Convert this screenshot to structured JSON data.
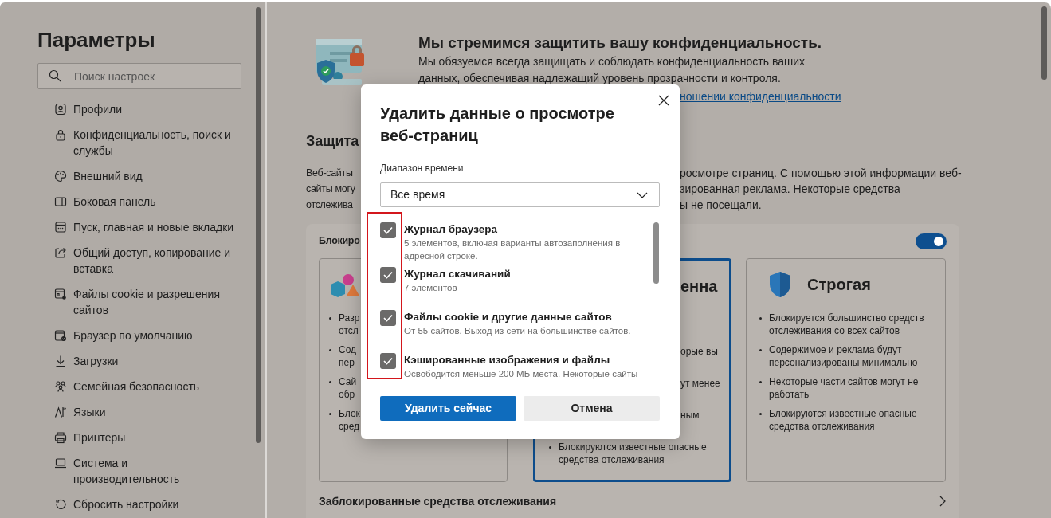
{
  "sidebar": {
    "title": "Параметры",
    "search": {
      "placeholder": "Поиск настроек"
    },
    "items": [
      {
        "label": "Профили",
        "selected": false
      },
      {
        "label": "Конфиденциальность, поиск и службы",
        "selected": false
      },
      {
        "label": "Внешний вид",
        "selected": false
      },
      {
        "label": "Боковая панель",
        "selected": false
      },
      {
        "label": "Пуск, главная и новые вкладки",
        "selected": false
      },
      {
        "label": "Общий доступ, копирование и вставка",
        "selected": false
      },
      {
        "label": "Файлы cookie и разрешения сайтов",
        "selected": false
      },
      {
        "label": "Браузер по умолчанию",
        "selected": false
      },
      {
        "label": "Загрузки",
        "selected": false
      },
      {
        "label": "Семейная безопасность",
        "selected": false
      },
      {
        "label": "Языки",
        "selected": false
      },
      {
        "label": "Принтеры",
        "selected": false
      },
      {
        "label": "Система и производительность",
        "selected": false
      },
      {
        "label": "Сбросить настройки",
        "selected": false
      }
    ]
  },
  "header": {
    "title": "Мы стремимся защитить вашу конфиденциальность.",
    "lines": [
      "Мы обязуемся всегда защищать и соблюдать конфиденциальность ваших",
      "данных, обеспечивая надлежащий уровень прозрачности и контроля."
    ],
    "link_fragment": "ношении конфиденциальности"
  },
  "tracking": {
    "heading_fragment": "Защита",
    "left_fragments": [
      "Веб-сайты",
      "сайты могу",
      "отслежива"
    ],
    "right_fragments": [
      "росмотре страниц. С помощью этой информации веб-",
      "зированная реклама. Некоторые средства",
      "ы не посещали."
    ]
  },
  "panel": {
    "title_fragment": "Блокиро",
    "enabled": true,
    "cards": [
      {
        "kind": "cut_right",
        "selected": false,
        "bullet_fragments": [
          [
            "Разр",
            "отсл"
          ],
          [
            "Сод",
            "пер"
          ],
          [
            "Сай",
            "обр"
          ],
          [
            "Блок",
            "сред"
          ]
        ]
      },
      {
        "kind": "cut_left",
        "selected": true,
        "title_fragment": "енна",
        "line_fragments": [
          "орые вы",
          "ут менее",
          "ным"
        ],
        "bullets": [
          "Блокируются известные опасные средства отслеживания"
        ]
      },
      {
        "kind": "whole",
        "selected": false,
        "title": "Строгая",
        "bullets": [
          "Блокируется большинство средств отслеживания со всех сайтов",
          "Содержимое и реклама будут персонализированы минимально",
          "Некоторые части сайтов могут не работать",
          "Блокируются известные опасные средства отслеживания"
        ]
      }
    ],
    "footer": "Заблокированные средства отслеживания"
  },
  "dialog": {
    "title": "Удалить данные о просмотре веб-страниц",
    "time_range": {
      "label": "Диапазон времени",
      "value": "Все время"
    },
    "items": [
      {
        "title": "Журнал браузера",
        "description": "5 элементов, включая варианты автозаполнения в адресной строке.",
        "checked": true
      },
      {
        "title": "Журнал скачиваний",
        "description": "7 элементов",
        "checked": true
      },
      {
        "title": "Файлы cookie и другие данные сайтов",
        "description": "От 55 сайтов. Выход из сети на большинстве сайтов.",
        "checked": true
      },
      {
        "title": "Кэшированные изображения и файлы",
        "description": "Освободится меньше 200 МБ места. Некоторые сайты",
        "checked": true
      }
    ],
    "buttons": [
      {
        "label": "Удалить сейчас",
        "kind": "primary"
      },
      {
        "label": "Отмена",
        "kind": "secondary"
      }
    ]
  }
}
